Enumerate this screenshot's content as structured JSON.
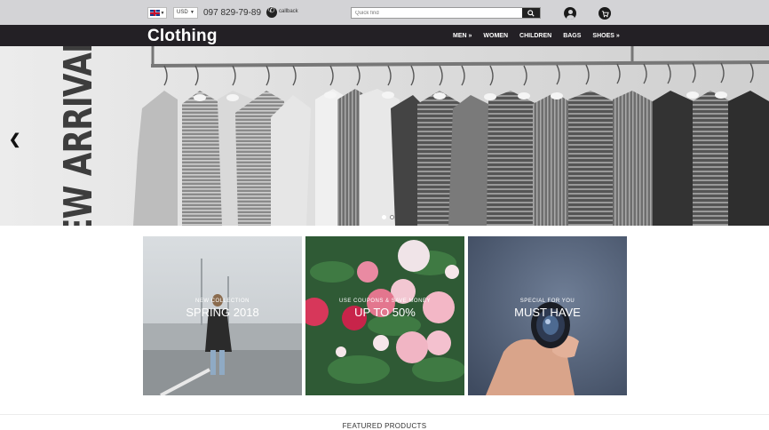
{
  "topbar": {
    "language_icon": "uk-flag-icon",
    "currency": "USD",
    "phone": "097 829-79-89",
    "callback_label": "callback",
    "search_placeholder": "Quick find",
    "icons": [
      "search-icon",
      "user-icon",
      "cart-icon"
    ]
  },
  "navbar": {
    "logo": "Clothing",
    "items": [
      "MEN »",
      "WOMEN",
      "CHILDREN",
      "BAGS",
      "SHOES »"
    ]
  },
  "hero": {
    "headline": "NEW ARRIVAL",
    "slide_count": 2,
    "active_slide": 1
  },
  "tiles": [
    {
      "subtitle": "NEW COLLECTION",
      "title": "SPRING 2018"
    },
    {
      "subtitle": "USE COUPONS & SAVE MONEY",
      "title": "UP TO 50%"
    },
    {
      "subtitle": "SPECIAL FOR YOU",
      "title": "MUST HAVE"
    }
  ],
  "featured_heading": "FEATURED PRODUCTS",
  "colors": {
    "topbar": "#d3d3d6",
    "navbar": "#232025"
  }
}
